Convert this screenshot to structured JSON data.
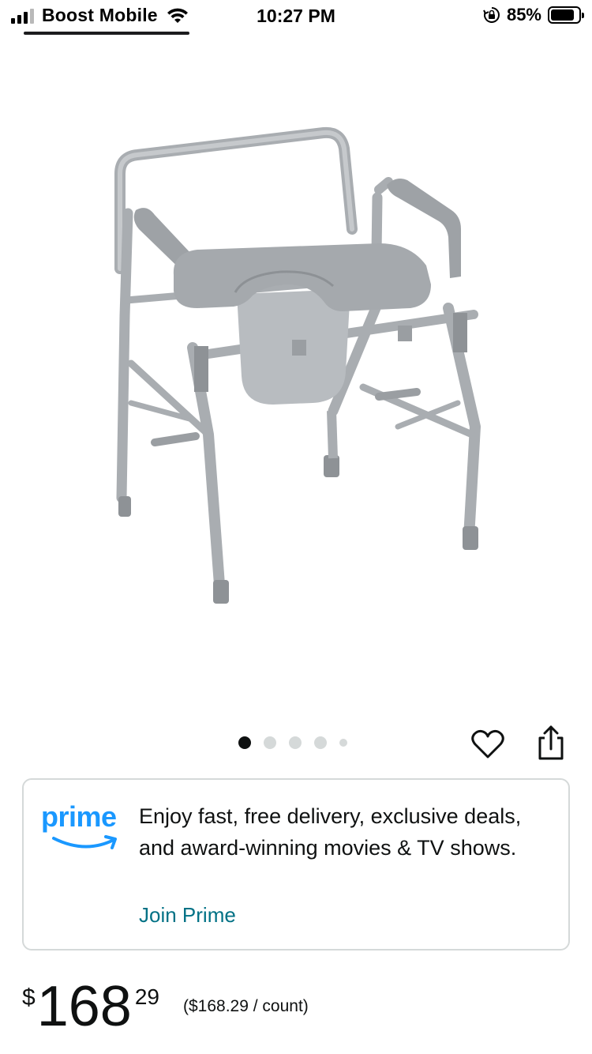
{
  "status_bar": {
    "carrier": "Boost Mobile",
    "time": "10:27 PM",
    "battery_percent": "85%",
    "battery_level": 0.85
  },
  "product": {
    "image_alt_icon": "commode-chair-image",
    "carousel": {
      "total": 5,
      "active_index": 0
    }
  },
  "prime_card": {
    "logo_text": "prime",
    "message": "Enjoy fast, free delivery, exclusive deals, and award-winning movies & TV shows.",
    "link": "Join Prime"
  },
  "price": {
    "symbol": "$",
    "whole": "168",
    "fraction": "29",
    "per_unit": "($168.29 / count)"
  },
  "colors": {
    "prime_blue": "#1a98ff",
    "link_teal": "#007185",
    "text": "#0f1111",
    "border": "#d5d9d9"
  }
}
